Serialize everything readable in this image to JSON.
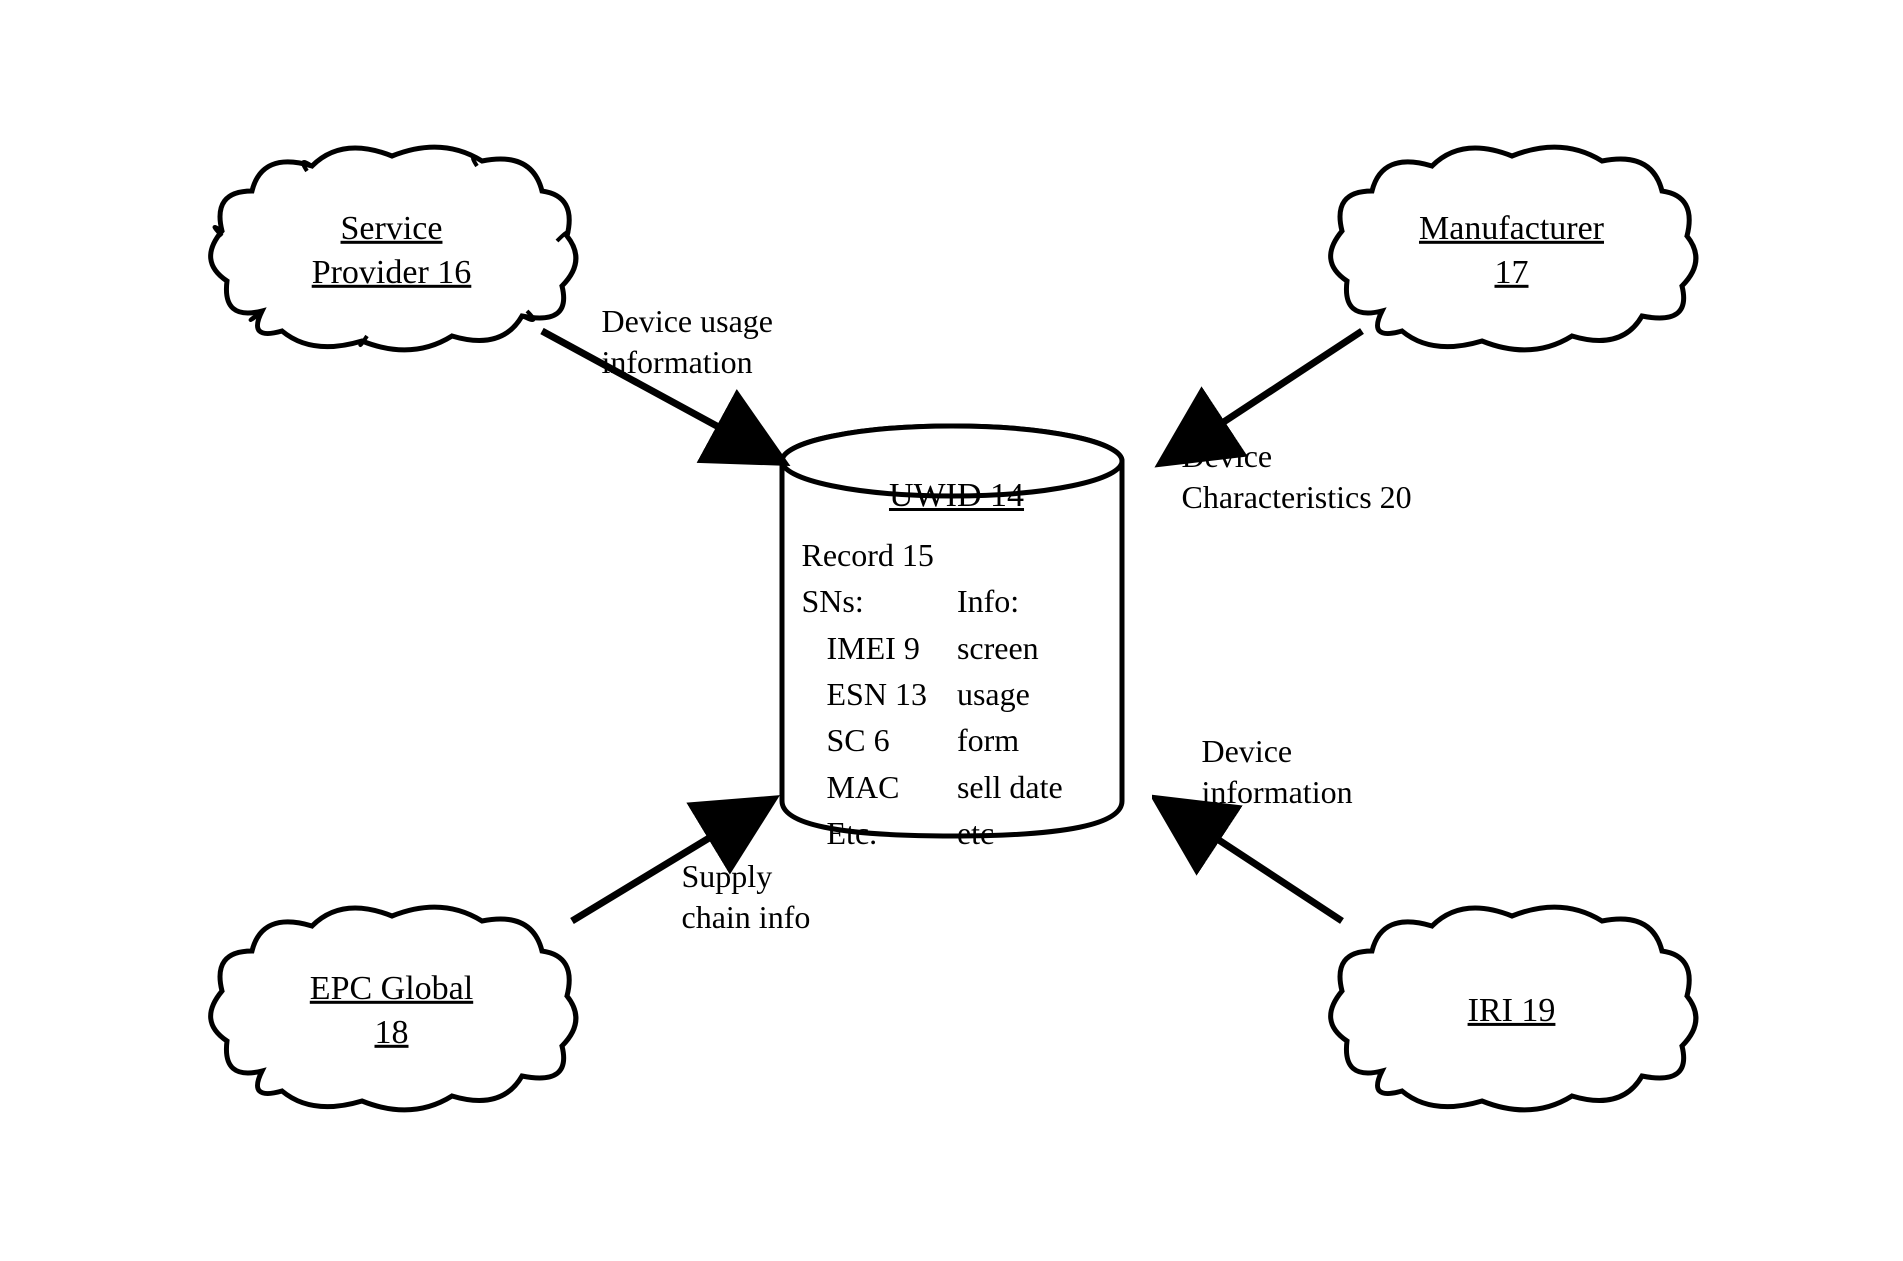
{
  "clouds": {
    "tl": {
      "line1": "Service",
      "line2": "Provider 16"
    },
    "tr": {
      "line1": "Manufacturer",
      "line2": "17"
    },
    "bl": {
      "line1": "EPC Global",
      "line2": "18"
    },
    "br": {
      "line1": "IRI 19"
    }
  },
  "cylinder": {
    "title": "UWID 14",
    "record_label": "Record 15",
    "sns_header": "SNs:",
    "sns": [
      "IMEI 9",
      "ESN 13",
      "SC 6",
      "MAC",
      "Etc."
    ],
    "info_header": "Info:",
    "info": [
      "screen",
      "usage",
      "form",
      "sell date",
      "etc"
    ]
  },
  "edges": {
    "tl": {
      "line1": "Device usage",
      "line2": "information"
    },
    "tr": {
      "line1": "Device",
      "line2": "Characteristics 20"
    },
    "bl": {
      "line1": "Supply",
      "line2": "chain info"
    },
    "br": {
      "line1": "Device",
      "line2": "information"
    }
  }
}
